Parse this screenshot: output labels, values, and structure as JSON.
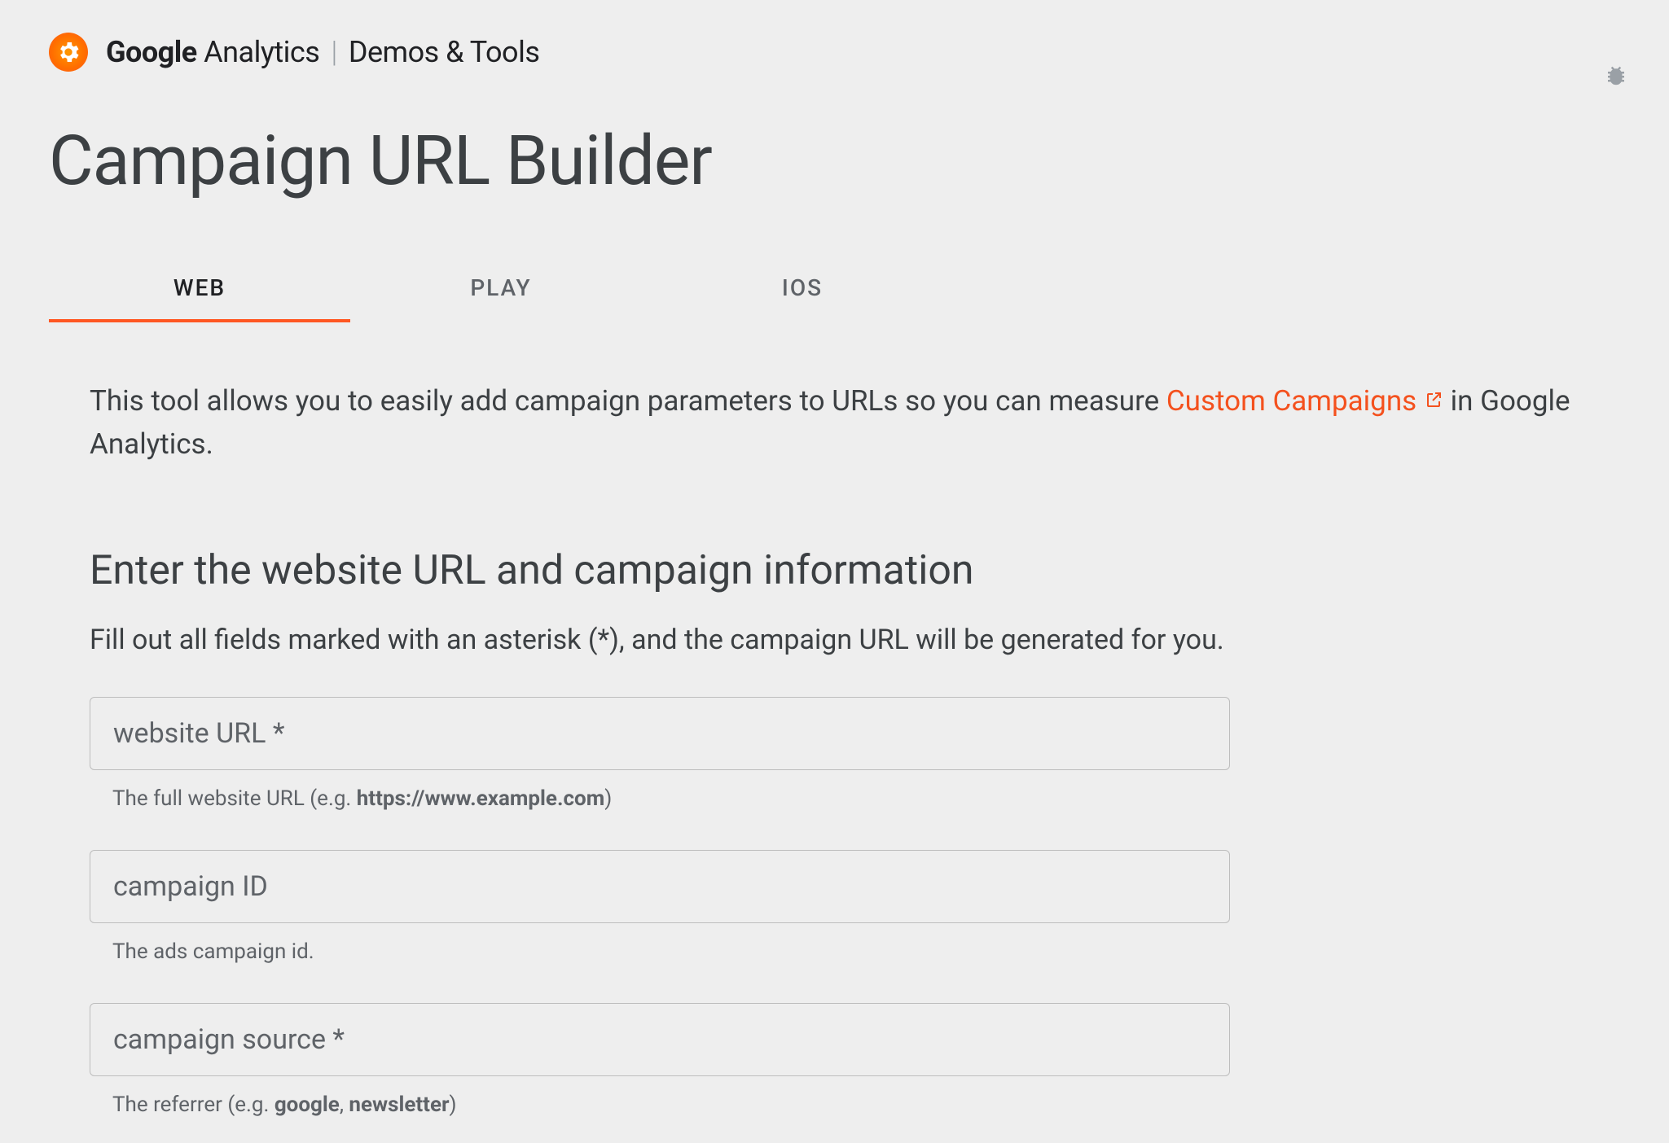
{
  "header": {
    "brand_bold": "Google",
    "brand_regular": " Analytics",
    "brand_separator": "|",
    "brand_sub": "Demos & Tools"
  },
  "page_title": "Campaign URL Builder",
  "tabs": {
    "web": "WEB",
    "play": "PLAY",
    "ios": "IOS"
  },
  "intro": {
    "pre": "This tool allows you to easily add campaign parameters to URLs so you can measure ",
    "link": "Custom Campaigns",
    "post": " in Google Analytics."
  },
  "section": {
    "heading": "Enter the website URL and campaign information",
    "sub": "Fill out all fields marked with an asterisk (*), and the campaign URL will be generated for you."
  },
  "fields": {
    "url": {
      "placeholder": "website URL *",
      "helper_pre": "The full website URL (e.g. ",
      "helper_bold": "https://www.example.com",
      "helper_post": ")"
    },
    "id": {
      "placeholder": "campaign ID",
      "helper": "The ads campaign id."
    },
    "source": {
      "placeholder": "campaign source *",
      "helper_pre": "The referrer (e.g. ",
      "helper_b1": "google",
      "helper_mid": ", ",
      "helper_b2": "newsletter",
      "helper_post": ")"
    }
  }
}
